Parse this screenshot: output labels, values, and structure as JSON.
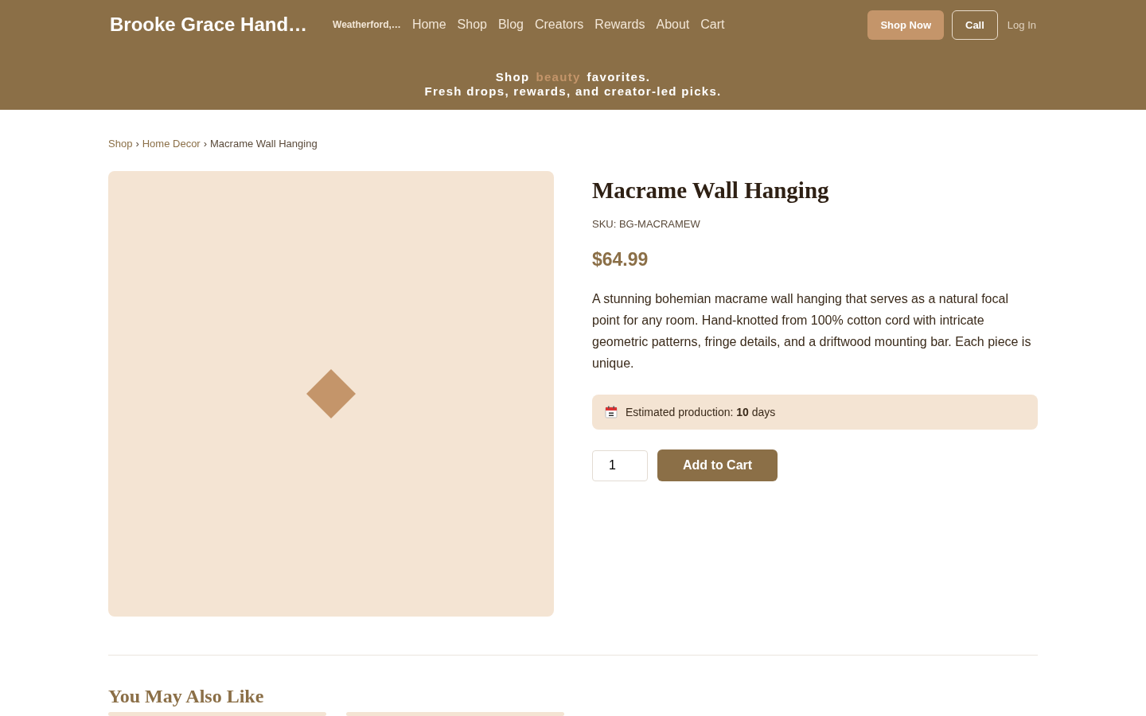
{
  "header": {
    "brand": "Brooke Grace Hand…",
    "location": "Weatherford,…",
    "nav": [
      {
        "label": "Home"
      },
      {
        "label": "Shop"
      },
      {
        "label": "Blog"
      },
      {
        "label": "Creators"
      },
      {
        "label": "Rewards"
      },
      {
        "label": "About"
      },
      {
        "label": "Cart"
      }
    ],
    "buttons": [
      {
        "label": "Shop Now",
        "kind": "filled"
      },
      {
        "label": "Call",
        "kind": "outline"
      },
      {
        "label": "Log In",
        "kind": "link"
      }
    ],
    "tagline": {
      "before": "Shop",
      "highlight": "beauty",
      "after": "favorites.",
      "line2": "Fresh drops, rewards, and creator-led picks."
    }
  },
  "breadcrumb": {
    "separator": "›",
    "items": [
      {
        "label": "Shop",
        "current": false
      },
      {
        "label": "Home Decor",
        "current": false
      },
      {
        "label": "Macrame Wall Hanging",
        "current": true
      }
    ]
  },
  "product": {
    "image": {
      "kind": "placeholder"
    },
    "title": "Macrame Wall Hanging",
    "sku": "SKU: BG-MACRAMEW",
    "price": "$64.99",
    "description": "A stunning bohemian macrame wall hanging that serves as a natural focal point for any room. Hand-knotted from 100% cotton cord with intricate geometric patterns, fringe details, and a driftwood mounting bar. Each piece is unique.",
    "production": "Estimated production: **10** days",
    "quantity": "1",
    "add_button": "Add to Cart"
  },
  "related": {
    "title": "You May Also Like",
    "cards": [
      {
        "kind": "placeholder"
      },
      {
        "kind": "placeholder"
      }
    ]
  }
}
